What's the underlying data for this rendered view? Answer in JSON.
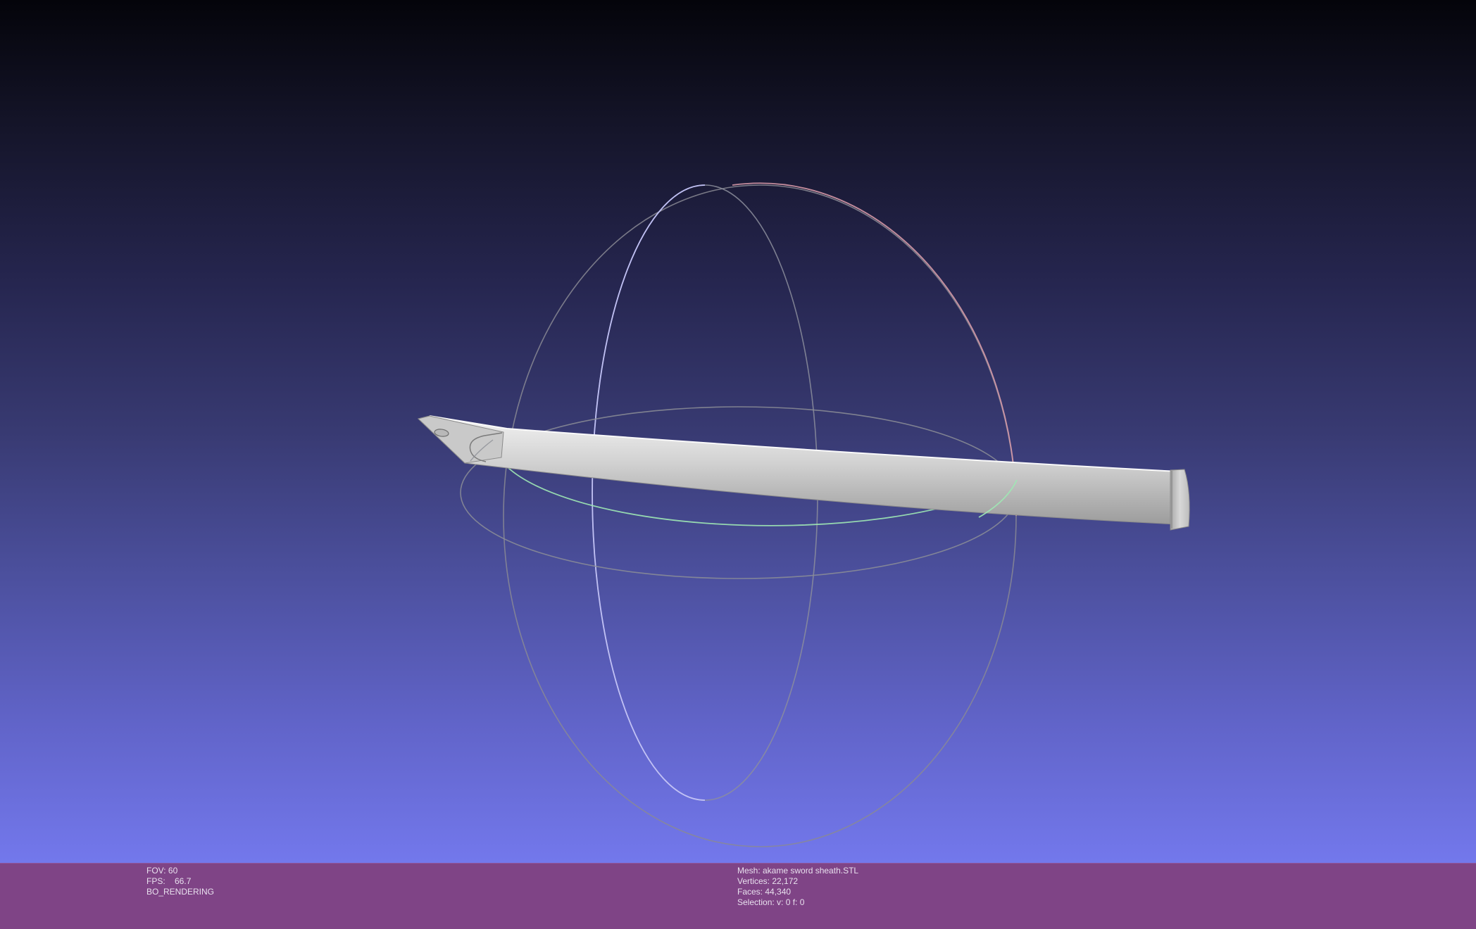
{
  "viewport": {
    "background_top": "#04040a",
    "background_bottom": "#7378ec",
    "model": "sword-sheath-mesh",
    "trackball": {
      "rings": [
        "red-ring",
        "green-ring",
        "blue-ring"
      ]
    }
  },
  "info_bar": {
    "color": "#7f4486",
    "render_stats": {
      "fov": "FOV: 60",
      "fps": "FPS:    66.7",
      "mode": "BO_RENDERING"
    },
    "mesh_info": {
      "mesh": "Mesh: akame sword sheath.STL",
      "vertices": "Vertices: 22,172",
      "faces": "Faces: 44,340",
      "selection": "Selection: v: 0 f: 0"
    }
  }
}
